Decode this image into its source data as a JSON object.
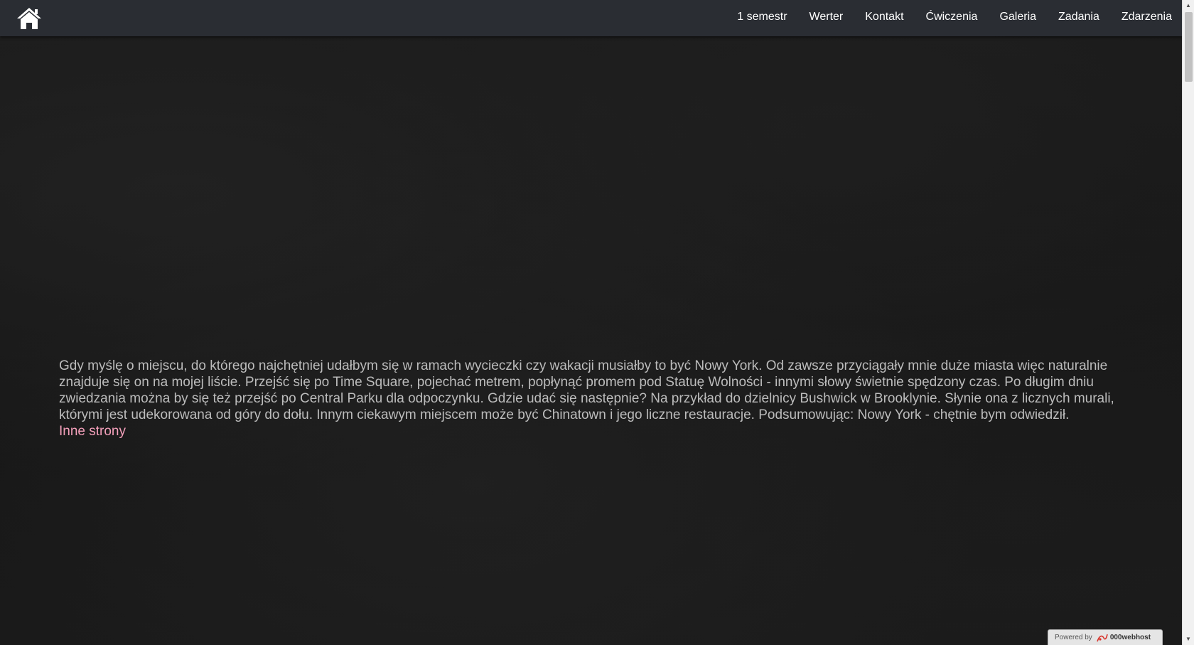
{
  "navbar": {
    "home_icon": "home-icon",
    "items": [
      {
        "label": "1 semestr"
      },
      {
        "label": "Werter"
      },
      {
        "label": "Kontakt"
      },
      {
        "label": "Ćwiczenia"
      },
      {
        "label": "Galeria"
      },
      {
        "label": "Zadania"
      },
      {
        "label": "Zdarzenia"
      }
    ]
  },
  "main": {
    "paragraph": "Gdy myślę o miejscu, do którego najchętniej udałbym się w ramach wycieczki czy wakacji musiałby to być Nowy York. Od zawsze przyciągały mnie duże miasta więc naturalnie znajduje się on na mojej liście. Przejść się po Time Square, pojechać metrem, popłynąć promem pod Statuę Wolności - innymi słowy świetnie spędzony czas. Po długim dniu zwiedzania można by się też przejść po Central Parku dla odpoczynku. Gdzie udać się następnie? Na przykład do dzielnicy Bushwick w Brooklynie. Słynie ona z licznych murali, którymi jest udekorowana od góry do dołu. Innym ciekawym miejscem może być Chinatown i jego liczne restauracje. Podsumowując: Nowy York - chętnie bym odwiedził.",
    "link_label": "Inne strony"
  },
  "badge": {
    "prefix": "Powered by",
    "brand": "000webhost"
  },
  "colors": {
    "navbar_bg": "#2a2d33",
    "text": "#bcbcbc",
    "link": "#f4a0bb",
    "background": "#171717"
  }
}
